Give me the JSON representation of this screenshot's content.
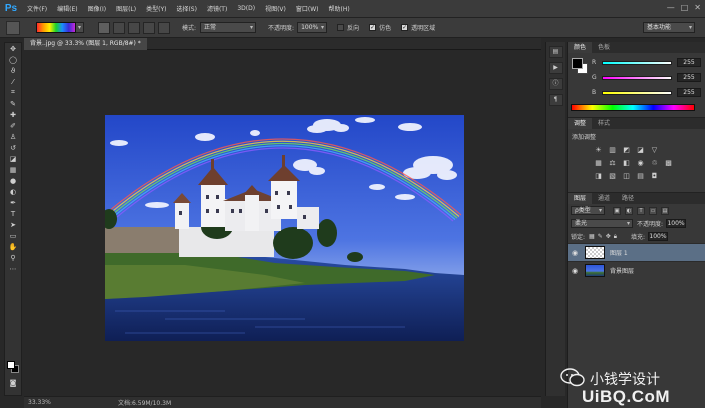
{
  "app": {
    "logo": "Ps"
  },
  "menu": [
    "文件(F)",
    "编辑(E)",
    "图像(I)",
    "图层(L)",
    "类型(Y)",
    "选择(S)",
    "滤镜(T)",
    "3D(D)",
    "视图(V)",
    "窗口(W)",
    "帮助(H)"
  ],
  "window_controls": [
    "—",
    "□",
    "✕"
  ],
  "options": {
    "mode_label": "模式:",
    "mode_value": "正常",
    "opacity_label": "不透明度:",
    "opacity_value": "100%",
    "reverse_label": "反向",
    "dither_label": "仿色",
    "transparency_label": "透明区域",
    "workspace": "基本功能"
  },
  "document": {
    "tab_title": "背景..jpg @ 33.3% (图层 1, RGB/8#) *",
    "zoom": "33.33%",
    "docinfo": "文档:6.59M/10.3M"
  },
  "color_panel": {
    "tabs": [
      "颜色",
      "色板"
    ],
    "channels": [
      {
        "label": "R",
        "value": "255"
      },
      {
        "label": "G",
        "value": "255"
      },
      {
        "label": "B",
        "value": "255"
      }
    ]
  },
  "adjustments": {
    "tabs": [
      "调整",
      "样式"
    ],
    "title": "添加调整"
  },
  "layers_panel": {
    "tabs": [
      "图层",
      "通道",
      "路径"
    ],
    "filter_kind": "ρ类型",
    "blend_mode": "柔光",
    "opacity_label": "不透明度:",
    "opacity_value": "100%",
    "lock_label": "锁定:",
    "fill_label": "填充:",
    "fill_value": "100%",
    "layers": [
      {
        "name": "图层 1",
        "selected": true
      },
      {
        "name": "背景图层",
        "selected": false
      }
    ]
  },
  "watermark": {
    "brand": "小钱学设计",
    "site": "UiBQ.CoM"
  }
}
